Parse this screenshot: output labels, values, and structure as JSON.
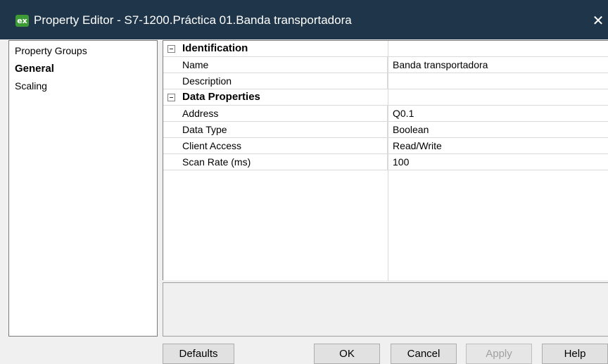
{
  "window": {
    "app_icon_text": "ex",
    "title": "Property Editor - S7-1200.Práctica 01.Banda transportadora",
    "close_glyph": "✕"
  },
  "property_groups": {
    "header": "Property Groups",
    "items": [
      "General",
      "Scaling"
    ],
    "selected": "General"
  },
  "sections": [
    {
      "title": "Identification",
      "rows": [
        {
          "name": "Name",
          "value": "Banda transportadora"
        },
        {
          "name": "Description",
          "value": ""
        }
      ]
    },
    {
      "title": "Data Properties",
      "rows": [
        {
          "name": "Address",
          "value": "Q0.1"
        },
        {
          "name": "Data Type",
          "value": "Boolean"
        },
        {
          "name": "Client Access",
          "value": "Read/Write"
        },
        {
          "name": "Scan Rate (ms)",
          "value": "100"
        }
      ]
    }
  ],
  "buttons": {
    "defaults": "Defaults",
    "ok": "OK",
    "cancel": "Cancel",
    "apply": "Apply",
    "help": "Help"
  },
  "icons": {
    "app": "exe-app-icon",
    "close": "close-icon",
    "collapse": "collapse-minus-icon"
  }
}
